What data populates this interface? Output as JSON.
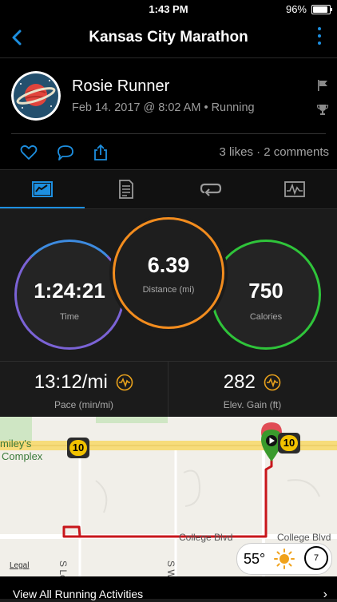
{
  "status_bar": {
    "time": "1:43 PM",
    "battery": "96%"
  },
  "nav": {
    "title": "Kansas City Marathon",
    "accent": "#1d8fe0"
  },
  "activity": {
    "user_name": "Rosie Runner",
    "meta": "Feb 14. 2017 @ 8:02 AM • Running"
  },
  "social": {
    "counts": "3 likes · 2 comments"
  },
  "tabs": [
    {
      "icon": "chart-icon",
      "active": true
    },
    {
      "icon": "document-icon",
      "active": false
    },
    {
      "icon": "laps-icon",
      "active": false
    },
    {
      "icon": "waveform-icon",
      "active": false
    }
  ],
  "rings": {
    "time": {
      "value": "1:24:21",
      "label": "Time",
      "color": "#7b63d6"
    },
    "distance": {
      "value": "6.39",
      "label": "Distance (mi)",
      "color": "#f28c1e"
    },
    "calories": {
      "value": "750",
      "label": "Calories",
      "color": "#2fc43a"
    }
  },
  "stats": {
    "pace": {
      "value": "13:12/mi",
      "label": "Pace (min/mi)"
    },
    "elevation": {
      "value": "282",
      "label": "Elev. Gain (ft)"
    }
  },
  "map": {
    "place": [
      "miley's",
      "Complex"
    ],
    "roads": {
      "college_1": "College Blvd",
      "college_2": "College Blvd",
      "s_lon": "S Lon",
      "s_wo": "S Wo"
    },
    "shield_left": "10",
    "shield_right": "10",
    "legal": "Legal",
    "weather": {
      "temp": "55°",
      "wind": "7"
    }
  },
  "footer": {
    "link": "View All Running Activities"
  }
}
